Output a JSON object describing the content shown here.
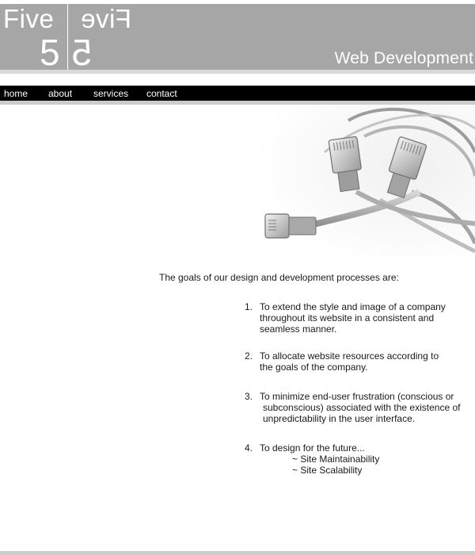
{
  "logo": {
    "word": "Five",
    "word_mirrored": "Five",
    "numeral": "5",
    "numeral_mirrored": "5",
    "tagline": "Web Development"
  },
  "nav": {
    "items": [
      {
        "label": "home"
      },
      {
        "label": "about"
      },
      {
        "label": "services"
      },
      {
        "label": "contact"
      }
    ]
  },
  "content": {
    "intro": "The goals of our design and development processes are:",
    "goals": [
      {
        "number": "1.",
        "lines": [
          "To extend the style and image of a company",
          "throughout its website in a consistent and",
          "seamless manner."
        ]
      },
      {
        "number": "2.",
        "lines": [
          "To allocate website resources according to",
          "the goals of the company."
        ]
      },
      {
        "number": "3.",
        "lines": [
          "To minimize end-user frustration (conscious or",
          "subconscious) associated with the existence of",
          "unpredictability in the user interface."
        ]
      },
      {
        "number": "4.",
        "lines": [
          "To design for the future..."
        ],
        "subitems": [
          "~ Site Maintainability",
          "~ Site Scalability"
        ]
      }
    ]
  },
  "colors": {
    "header_bg": "#a6a6a6",
    "nav_bg": "#000000",
    "band": "#cccccc"
  },
  "icons": {
    "hero": "network-cables-image"
  }
}
